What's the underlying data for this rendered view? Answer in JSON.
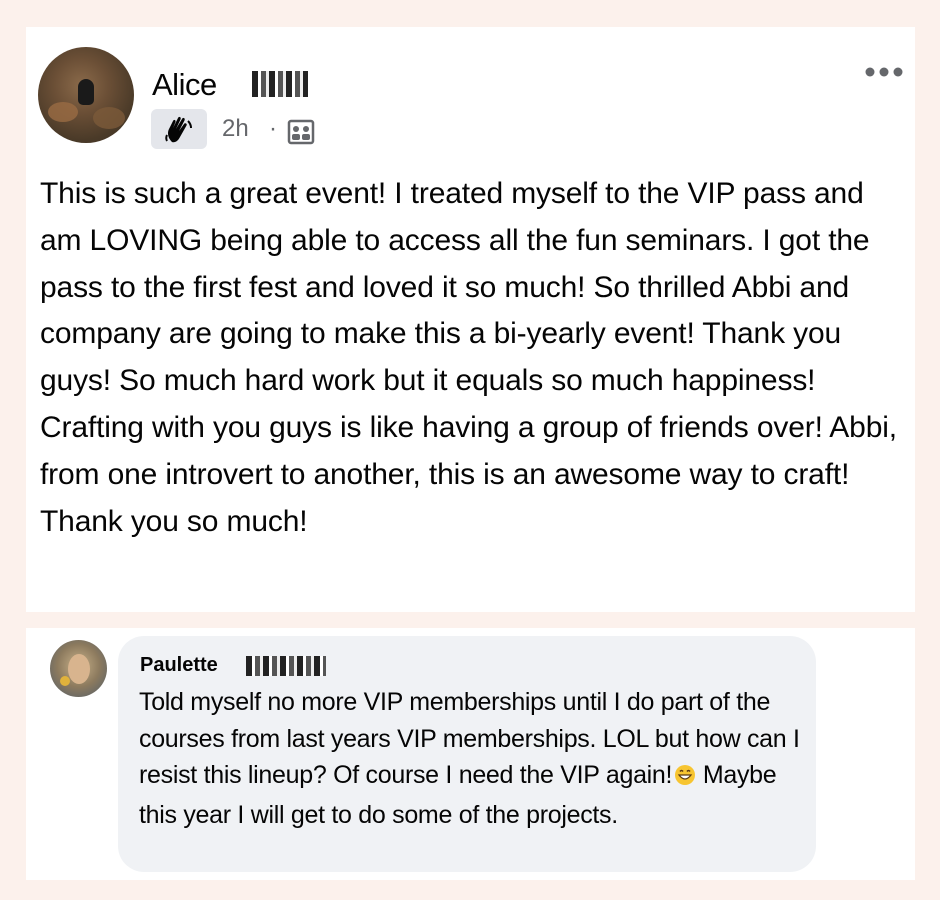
{
  "post": {
    "author_name": "Alice",
    "timestamp": "2h",
    "separator": "·",
    "text": "This is such a great event! I treated myself to the VIP pass and am LOVING being able to access all the fun seminars. I got the pass to the first fest and loved it so much! So thrilled Abbi and company are going to make this a bi-yearly event! Thank you guys! So much hard work but it equals so much happiness! Crafting with you guys is like having a group of friends over! Abbi, from one introvert to another, this is an awesome way to craft! Thank you so much!",
    "icons": {
      "badge": "waving-hand-icon",
      "audience": "group-audience-icon",
      "more": "more-options-icon"
    }
  },
  "comment": {
    "author_name": "Paulette",
    "text_part1": "Told myself no more VIP memberships until I do part of the courses from last years VIP memberships. LOL but how can I resist this lineup? Of course I need the VIP again!",
    "emoji": "grinning-face-emoji",
    "text_part2": " Maybe this year I will get to do some of the projects."
  },
  "colors": {
    "page_background": "#fcf1ec",
    "card_background": "#ffffff",
    "bubble_background": "#f0f2f5",
    "secondary_text": "#65676b",
    "primary_text": "#050505"
  }
}
